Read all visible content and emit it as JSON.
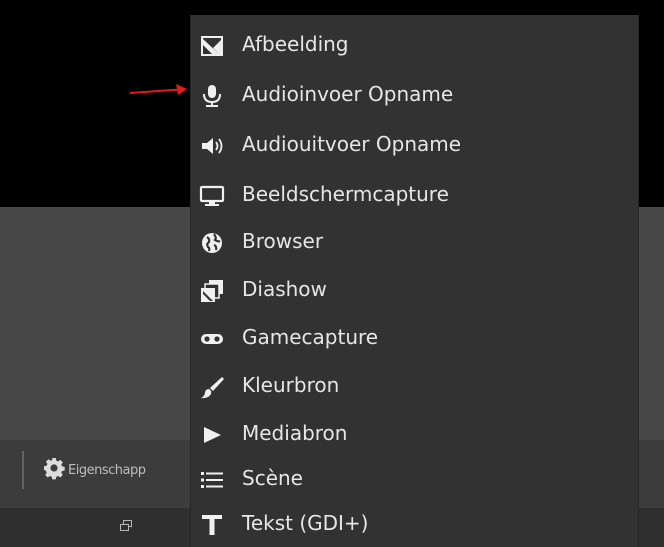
{
  "toolbar": {
    "properties_label": "Eigenschapp"
  },
  "menu": {
    "items": [
      {
        "label": "Afbeelding",
        "icon": "image-icon"
      },
      {
        "label": "Audioinvoer Opname",
        "icon": "microphone-icon"
      },
      {
        "label": "Audiouitvoer Opname",
        "icon": "speaker-icon"
      },
      {
        "label": "Beeldschermcapture",
        "icon": "monitor-icon"
      },
      {
        "label": "Browser",
        "icon": "globe-icon"
      },
      {
        "label": "Diashow",
        "icon": "slideshow-icon"
      },
      {
        "label": "Gamecapture",
        "icon": "gamepad-icon"
      },
      {
        "label": "Kleurbron",
        "icon": "paintbrush-icon"
      },
      {
        "label": "Mediabron",
        "icon": "play-icon"
      },
      {
        "label": "Scène",
        "icon": "list-icon"
      },
      {
        "label": "Tekst (GDI+)",
        "icon": "text-icon"
      }
    ]
  },
  "colors": {
    "menu_bg": "#323232",
    "menu_text": "#e6e6e6",
    "arrow": "#e11b1b",
    "preview_bg": "#000000"
  }
}
